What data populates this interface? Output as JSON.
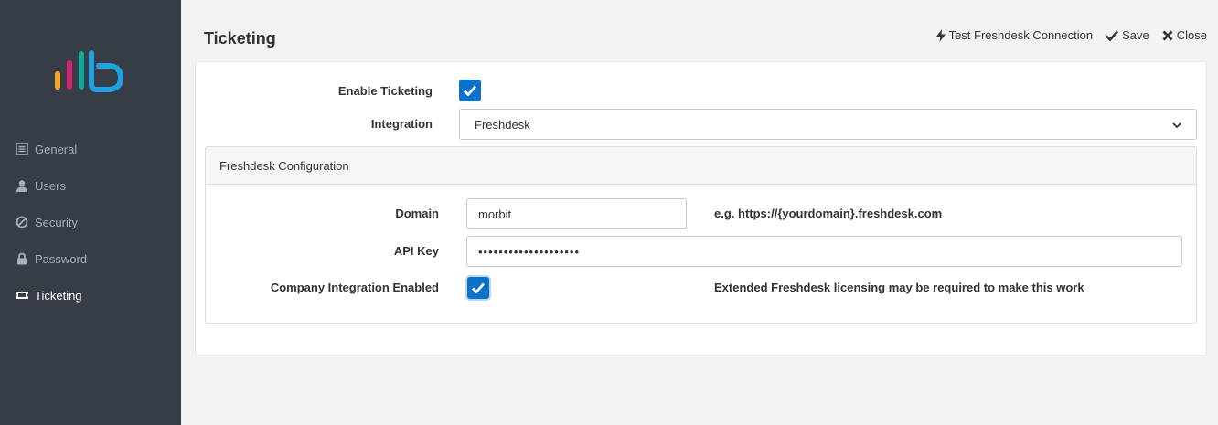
{
  "sidebar": {
    "items": [
      {
        "label": "General",
        "icon": "list-icon"
      },
      {
        "label": "Users",
        "icon": "user-icon"
      },
      {
        "label": "Security",
        "icon": "ban-icon"
      },
      {
        "label": "Password",
        "icon": "lock-icon"
      },
      {
        "label": "Ticketing",
        "icon": "ticket-icon"
      }
    ],
    "active": "Ticketing"
  },
  "header": {
    "title": "Ticketing",
    "actions": {
      "test": "Test Freshdesk Connection",
      "save": "Save",
      "close": "Close"
    }
  },
  "form": {
    "enable_label": "Enable Ticketing",
    "enable_checked": true,
    "integration_label": "Integration",
    "integration_value": "Freshdesk"
  },
  "panel": {
    "title": "Freshdesk Configuration",
    "domain_label": "Domain",
    "domain_value": "morbit",
    "domain_hint": "e.g. https://{yourdomain}.freshdesk.com",
    "apikey_label": "API Key",
    "apikey_value": "••••••••••••••••••••",
    "company_label": "Company Integration Enabled",
    "company_checked": true,
    "company_hint": "Extended Freshdesk licensing may be required to make this work"
  },
  "colors": {
    "sidebar_bg": "#363d47",
    "accent": "#0b72c9",
    "logo": [
      "#f5a623",
      "#d6246e",
      "#14a89b",
      "#1fa3e0"
    ]
  }
}
